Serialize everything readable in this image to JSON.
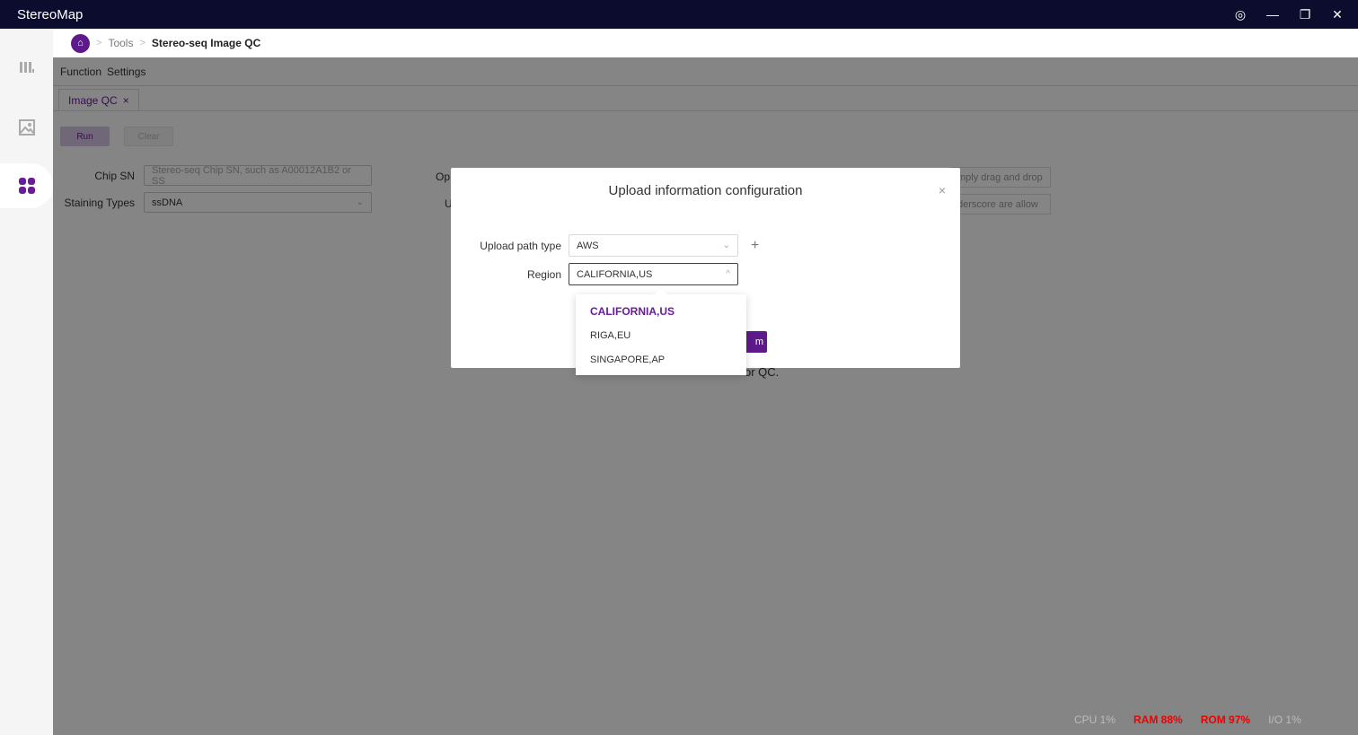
{
  "window": {
    "title": "StereoMap",
    "settings_icon": "◎",
    "minimize_icon": "—",
    "restore_icon": "❐",
    "close_icon": "✕"
  },
  "sidebar": {
    "items": [
      {
        "icon": "map-icon",
        "glyph": "▥"
      },
      {
        "icon": "image-icon",
        "glyph": "▨"
      },
      {
        "icon": "apps-icon",
        "glyph": "■"
      }
    ]
  },
  "breadcrumb": {
    "home_glyph": "⌂",
    "sep": ">",
    "items": [
      "Tools",
      "Stereo-seq Image QC"
    ]
  },
  "menu": {
    "function": "Function",
    "settings": "Settings"
  },
  "tabs": [
    {
      "label": "Image QC",
      "close": "×"
    }
  ],
  "actions": {
    "run": "Run",
    "clear": "Clear"
  },
  "form": {
    "chip_sn_label": "Chip SN",
    "chip_sn_placeholder": "Stereo-seq Chip SN, such as A00012A1B2 or SS",
    "staining_label": "Staining Types",
    "staining_value": "ssDNA",
    "op_label_partial": "Op",
    "u_label_partial": "U",
    "drop_hint_partial": "mply drag and drop",
    "underscore_hint_partial": "derscore are allow",
    "bg_hint_partial": "or QC."
  },
  "modal": {
    "title": "Upload information configuration",
    "close": "×",
    "upload_path_label": "Upload path type",
    "upload_path_value": "AWS",
    "region_label": "Region",
    "region_value": "CALIFORNIA,US",
    "confirm_partial": "m"
  },
  "region_options": [
    "CALIFORNIA,US",
    "RIGA,EU",
    "SINGAPORE,AP"
  ],
  "status": {
    "cpu": "CPU  1%",
    "ram": "RAM  88%",
    "rom": "ROM  97%",
    "io": "I/O  1%"
  },
  "colors": {
    "accent": "#6a1b9a",
    "titlebar": "#0c0c2e",
    "alert": "#e00000"
  }
}
